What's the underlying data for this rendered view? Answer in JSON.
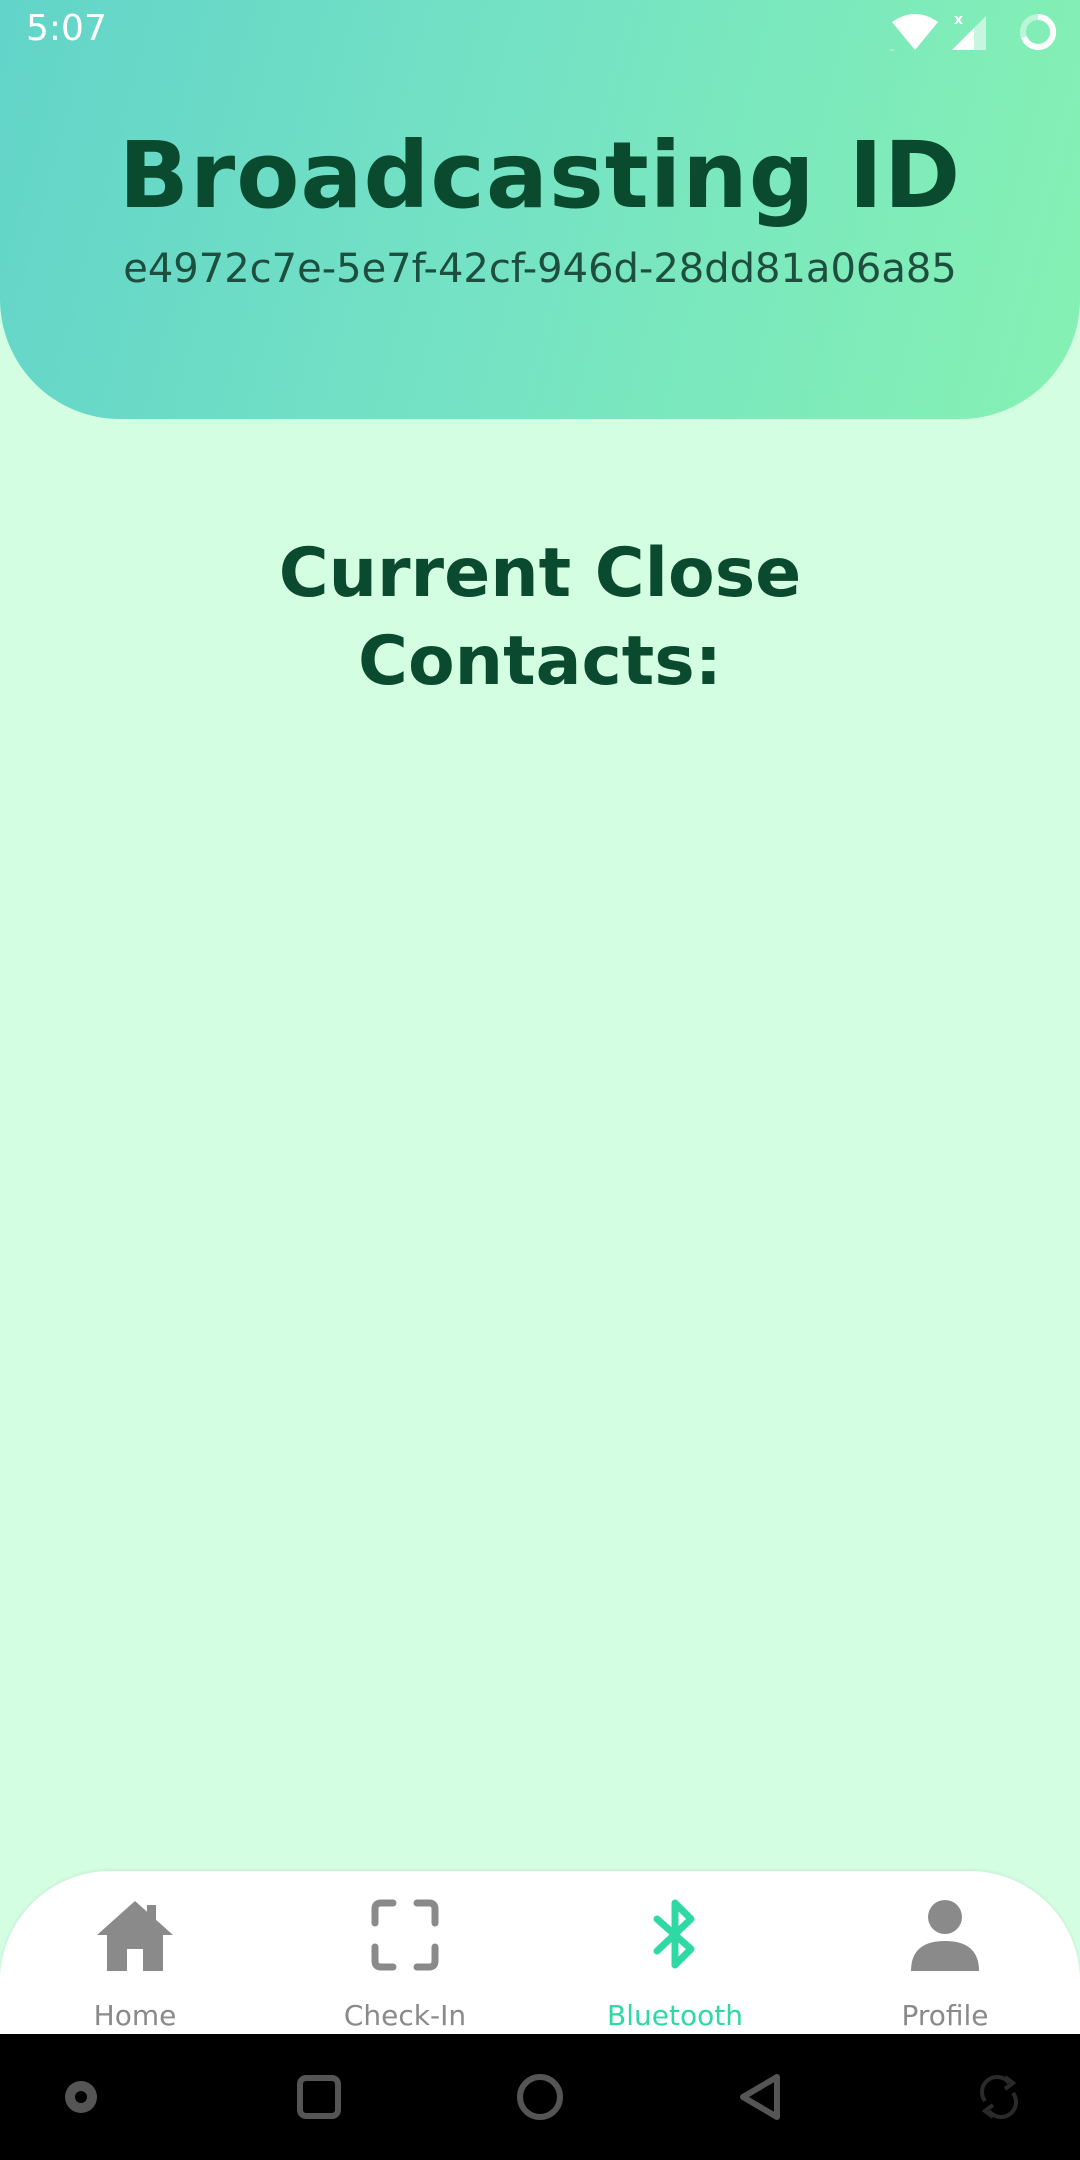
{
  "status_bar": {
    "time": "5:07",
    "icons": [
      "wifi-icon",
      "signal-icon",
      "battery-icon"
    ]
  },
  "header": {
    "title": "Broadcasting ID",
    "broadcast_id": "e4972c7e-5e7f-42cf-946d-28dd81a06a85"
  },
  "main": {
    "contacts_heading": "Current Close Contacts:",
    "contacts": []
  },
  "bottom_nav": {
    "items": [
      {
        "label": "Home",
        "icon": "home-icon",
        "active": false
      },
      {
        "label": "Check-In",
        "icon": "scan-frame-icon",
        "active": false
      },
      {
        "label": "Bluetooth",
        "icon": "bluetooth-icon",
        "active": true
      },
      {
        "label": "Profile",
        "icon": "person-icon",
        "active": false
      }
    ]
  },
  "system_nav": {
    "icons": [
      "dot-icon",
      "recents-icon",
      "home-circle-icon",
      "back-icon",
      "rotate-icon"
    ]
  },
  "colors": {
    "background": "#d3fee2",
    "header_gradient_start": "#62d4c9",
    "header_gradient_end": "#86f1b3",
    "title_text": "#0a4a2f",
    "active_accent": "#2fd9a4",
    "inactive_icon": "#8a8a8a"
  }
}
